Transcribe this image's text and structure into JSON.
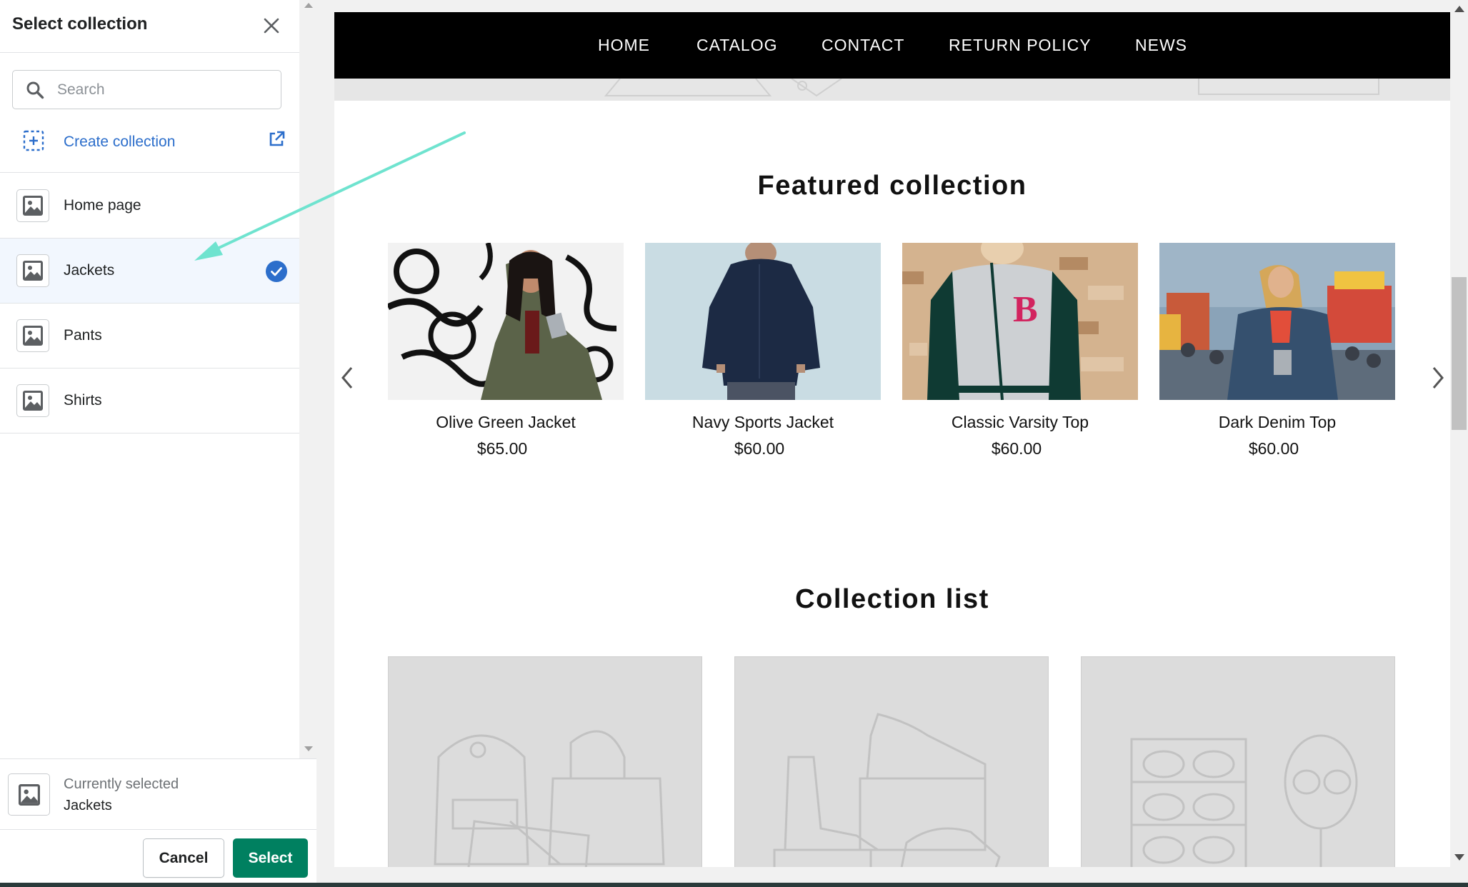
{
  "sidebar": {
    "title": "Select collection",
    "search_placeholder": "Search",
    "create_label": "Create collection",
    "items": [
      {
        "name": "Home page",
        "selected": false
      },
      {
        "name": "Jackets",
        "selected": true
      },
      {
        "name": "Pants",
        "selected": false
      },
      {
        "name": "Shirts",
        "selected": false
      }
    ],
    "current_label": "Currently selected",
    "current_value": "Jackets",
    "cancel_label": "Cancel",
    "select_label": "Select"
  },
  "preview": {
    "nav": [
      "HOME",
      "CATALOG",
      "CONTACT",
      "RETURN POLICY",
      "NEWS"
    ],
    "featured_title": "Featured collection",
    "products": [
      {
        "name": "Olive Green Jacket",
        "price": "$65.00"
      },
      {
        "name": "Navy Sports Jacket",
        "price": "$60.00"
      },
      {
        "name": "Classic Varsity Top",
        "price": "$60.00"
      },
      {
        "name": "Dark Denim Top",
        "price": "$60.00"
      }
    ],
    "collection_list_title": "Collection list"
  },
  "colors": {
    "primary_button": "#008060",
    "link": "#2c6ecb",
    "check": "#2c6ecb",
    "selected_row": "#f2f7fe",
    "annotation_arrow": "#6fe3cf"
  },
  "icons": [
    "close-icon",
    "search-icon",
    "add-collection-icon",
    "external-link-icon",
    "image-placeholder-icon",
    "checkmark-circle-icon",
    "chevron-left-icon",
    "chevron-right-icon"
  ]
}
